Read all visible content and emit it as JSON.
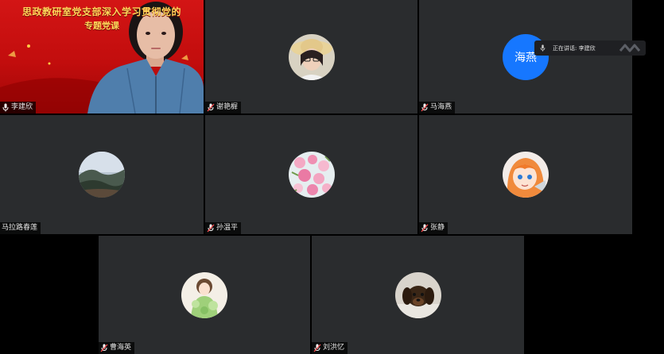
{
  "speaker_tile": {
    "banner_line1": "思政教研室党支部深入学习贯彻党的",
    "banner_line2": "专题党课",
    "name": "李建欣"
  },
  "participants": [
    {
      "name": "谢艳樨",
      "avatar": "avatar-photo-hat"
    },
    {
      "name": "马海燕",
      "avatar_text": "海燕",
      "avatar_color": "#1677ff"
    },
    {
      "name": "马拉路春莲",
      "avatar": "avatar-landscape"
    },
    {
      "name": "孙温平",
      "avatar": "avatar-flowers"
    },
    {
      "name": "张静",
      "avatar": "avatar-anime-girl"
    },
    {
      "name": "曹海英",
      "avatar": "avatar-cartoon-green"
    },
    {
      "name": "刘洪忆",
      "avatar": "avatar-puppy"
    }
  ],
  "speaking_indicator": {
    "text": "正在讲话: 李建欣"
  },
  "colors": {
    "tile_bg": "#2a2c2e",
    "stage_bg": "#000000",
    "accent_blue": "#1677ff",
    "banner_red": "#d31515",
    "banner_text": "#ffd75a"
  }
}
